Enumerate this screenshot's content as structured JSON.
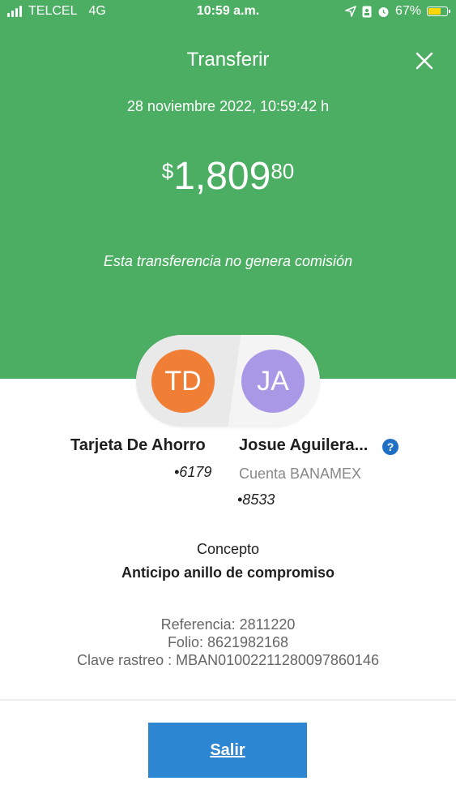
{
  "status_bar": {
    "carrier": "TELCEL",
    "network": "4G",
    "time": "10:59 a.m.",
    "battery_percent": "67%",
    "battery_level": 0.67
  },
  "header": {
    "title": "Transferir",
    "datetime": "28 noviembre 2022, 10:59:42 h",
    "amount_currency": "$",
    "amount_integer": "1,809",
    "amount_decimal": "80",
    "fee_note": "Esta transferencia no genera comisión"
  },
  "colors": {
    "header_bg": "#4cae63",
    "button_bg": "#2d86d1",
    "avatar_from": "#f07e35",
    "avatar_to": "#a998e6"
  },
  "from_account": {
    "initials": "TD",
    "name": "Tarjeta De Ahorro",
    "number": "•6179"
  },
  "to_account": {
    "initials": "JA",
    "name": "Josue Aguilera...",
    "bank": "Cuenta BANAMEX",
    "number": "•8533",
    "help_icon": "?"
  },
  "concept": {
    "label": "Concepto",
    "value": "Anticipo anillo de compromiso"
  },
  "details": {
    "referencia": "Referencia: 2811220",
    "folio": "Folio: 8621982168",
    "clave_rastreo": "Clave rastreo : MBAN01002211280097860146"
  },
  "actions": {
    "exit_label": "Salir"
  }
}
